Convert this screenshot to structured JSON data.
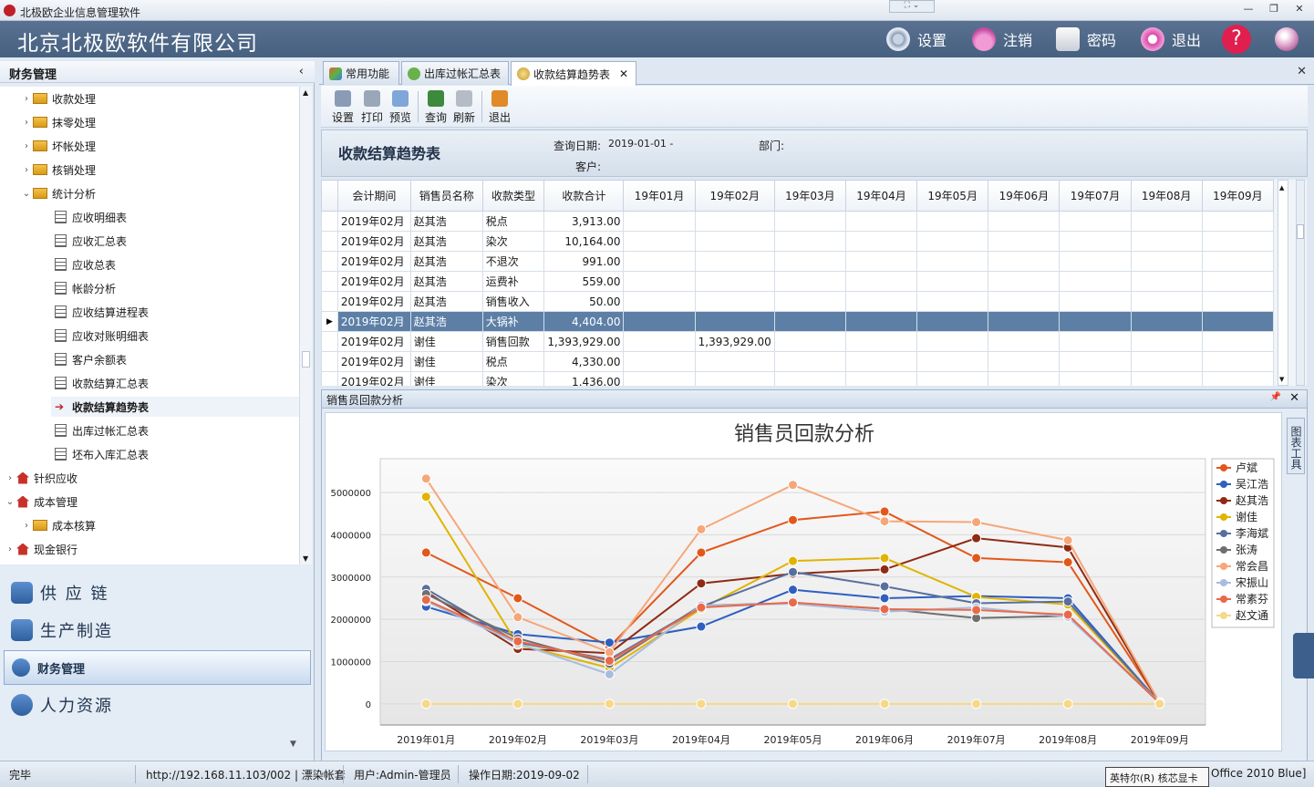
{
  "window": {
    "title": "北极欧企业信息管理软件"
  },
  "header": {
    "company": "北京北极欧软件有限公司",
    "buttons": [
      {
        "label": "设置",
        "icon": "gear-icon"
      },
      {
        "label": "注销",
        "icon": "lock-icon"
      },
      {
        "label": "密码",
        "icon": "key-icon"
      },
      {
        "label": "退出",
        "icon": "power-icon"
      }
    ],
    "help_icon": "question-icon",
    "globe_icon": "globe-icon"
  },
  "sidebar": {
    "title": "财务管理",
    "collapse_glyph": "‹",
    "tree": [
      {
        "label": "收款处理",
        "type": "folder",
        "level": 1
      },
      {
        "label": "抹零处理",
        "type": "folder",
        "level": 1
      },
      {
        "label": "坏帐处理",
        "type": "folder",
        "level": 1
      },
      {
        "label": "核销处理",
        "type": "folder",
        "level": 1
      },
      {
        "label": "统计分析",
        "type": "folder-open",
        "level": 1
      },
      {
        "label": "应收明细表",
        "type": "doc",
        "level": 2
      },
      {
        "label": "应收汇总表",
        "type": "doc",
        "level": 2
      },
      {
        "label": "应收总表",
        "type": "doc",
        "level": 2
      },
      {
        "label": "帐龄分析",
        "type": "doc",
        "level": 2
      },
      {
        "label": "应收结算进程表",
        "type": "doc",
        "level": 2
      },
      {
        "label": "应收对账明细表",
        "type": "doc",
        "level": 2
      },
      {
        "label": "客户余额表",
        "type": "doc",
        "level": 2
      },
      {
        "label": "收款结算汇总表",
        "type": "doc",
        "level": 2
      },
      {
        "label": "收款结算趋势表",
        "type": "current",
        "level": 2
      },
      {
        "label": "出库过帐汇总表",
        "type": "doc",
        "level": 2
      },
      {
        "label": "坯布入库汇总表",
        "type": "doc",
        "level": 2
      },
      {
        "label": "针织应收",
        "type": "house",
        "level": 0
      },
      {
        "label": "成本管理",
        "type": "house-open",
        "level": 0
      },
      {
        "label": "成本核算",
        "type": "folder",
        "level": 1
      },
      {
        "label": "现金银行",
        "type": "house",
        "level": 0
      }
    ],
    "nav": [
      {
        "label": "供 应 链",
        "icon": "chain-icon"
      },
      {
        "label": "生产制造",
        "icon": "gear-icon"
      },
      {
        "label": "财务管理",
        "icon": "heart-icon",
        "active": true
      },
      {
        "label": "人力资源",
        "icon": "person-icon"
      }
    ]
  },
  "tabs": [
    {
      "label": "常用功能"
    },
    {
      "label": "出库过帐汇总表"
    },
    {
      "label": "收款结算趋势表",
      "active": true
    }
  ],
  "toolbar": [
    "设置",
    "打印",
    "预览",
    "查询",
    "刷新",
    "退出"
  ],
  "report": {
    "title": "收款结算趋势表",
    "date_label": "查询日期:",
    "date_value": "2019-01-01  -",
    "dept_label": "部门:",
    "customer_label": "客户:"
  },
  "grid": {
    "columns": [
      "会计期间",
      "销售员名称",
      "收款类型",
      "收款合计",
      "19年01月",
      "19年02月",
      "19年03月",
      "19年04月",
      "19年05月",
      "19年06月",
      "19年07月",
      "19年08月",
      "19年09月"
    ],
    "rows": [
      [
        "2019年02月",
        "赵其浩",
        "税点",
        "3,913.00",
        "",
        "",
        "",
        "",
        "",
        "",
        "",
        "",
        ""
      ],
      [
        "2019年02月",
        "赵其浩",
        "染次",
        "10,164.00",
        "",
        "",
        "",
        "",
        "",
        "",
        "",
        "",
        ""
      ],
      [
        "2019年02月",
        "赵其浩",
        "不退次",
        "991.00",
        "",
        "",
        "",
        "",
        "",
        "",
        "",
        "",
        ""
      ],
      [
        "2019年02月",
        "赵其浩",
        "运费补",
        "559.00",
        "",
        "",
        "",
        "",
        "",
        "",
        "",
        "",
        ""
      ],
      [
        "2019年02月",
        "赵其浩",
        "销售收入",
        "50.00",
        "",
        "",
        "",
        "",
        "",
        "",
        "",
        "",
        ""
      ],
      [
        "2019年02月",
        "赵其浩",
        "大锅补",
        "4,404.00",
        "",
        "",
        "",
        "",
        "",
        "",
        "",
        "",
        ""
      ],
      [
        "2019年02月",
        "谢佳",
        "销售回款",
        "1,393,929.00",
        "",
        "1,393,929.00",
        "",
        "",
        "",
        "",
        "",
        "",
        ""
      ],
      [
        "2019年02月",
        "谢佳",
        "税点",
        "4,330.00",
        "",
        "",
        "",
        "",
        "",
        "",
        "",
        "",
        ""
      ],
      [
        "2019年02月",
        "谢佳",
        "染次",
        "1,436.00",
        "",
        "",
        "",
        "",
        "",
        "",
        "",
        "",
        ""
      ]
    ],
    "selected_row": 5
  },
  "panel": {
    "title": "销售员回款分析",
    "side_tool": "图表工具"
  },
  "chart_data": {
    "type": "line",
    "title": "销售员回款分析",
    "categories": [
      "2019年01月",
      "2019年02月",
      "2019年03月",
      "2019年04月",
      "2019年05月",
      "2019年06月",
      "2019年07月",
      "2019年08月",
      "2019年09月"
    ],
    "ylim": [
      -500000,
      5800000
    ],
    "yticks": [
      0,
      1000000,
      2000000,
      3000000,
      4000000,
      5000000
    ],
    "grid": true,
    "legend": "right",
    "series": [
      {
        "name": "卢斌",
        "color": "#e2581b",
        "values": [
          3580000,
          2500000,
          1350000,
          3580000,
          4350000,
          4550000,
          3450000,
          3350000,
          20000
        ]
      },
      {
        "name": "吴江浩",
        "color": "#2f5fbf",
        "values": [
          2300000,
          1650000,
          1450000,
          1830000,
          2700000,
          2500000,
          2550000,
          2500000,
          20000
        ]
      },
      {
        "name": "赵其浩",
        "color": "#8f2a14",
        "values": [
          2650000,
          1300000,
          1200000,
          2850000,
          3080000,
          3180000,
          3920000,
          3700000,
          20000
        ]
      },
      {
        "name": "谢佳",
        "color": "#e0b400",
        "values": [
          4900000,
          1400000,
          850000,
          2250000,
          3380000,
          3450000,
          2530000,
          2350000,
          20000
        ]
      },
      {
        "name": "李海斌",
        "color": "#586f9e",
        "values": [
          2720000,
          1450000,
          1050000,
          2300000,
          3120000,
          2780000,
          2380000,
          2420000,
          30000
        ]
      },
      {
        "name": "张涛",
        "color": "#6f6f6f",
        "values": [
          2600000,
          1550000,
          950000,
          2330000,
          2380000,
          2250000,
          2030000,
          2080000,
          20000
        ]
      },
      {
        "name": "常会昌",
        "color": "#f5a77a",
        "values": [
          5330000,
          2050000,
          1220000,
          4130000,
          5180000,
          4320000,
          4300000,
          3870000,
          30000
        ]
      },
      {
        "name": "宋振山",
        "color": "#a7bde0",
        "values": [
          2430000,
          1430000,
          700000,
          2330000,
          2370000,
          2180000,
          2280000,
          2060000,
          40000
        ]
      },
      {
        "name": "常素芬",
        "color": "#e96a4a",
        "values": [
          2460000,
          1480000,
          1020000,
          2280000,
          2400000,
          2240000,
          2220000,
          2110000,
          20000
        ]
      },
      {
        "name": "赵文通",
        "color": "#f6d887",
        "values": [
          0,
          0,
          0,
          0,
          0,
          0,
          0,
          0,
          0
        ]
      }
    ]
  },
  "status": {
    "state": "完毕",
    "url": "http://192.168.11.103/002 | 漂染帐套",
    "user": "用户:Admin-管理员",
    "date": "操作日期:2019-09-02",
    "ime_tip": "英特尔(R) 核芯显卡",
    "theme": "Office 2010 Blue]"
  }
}
